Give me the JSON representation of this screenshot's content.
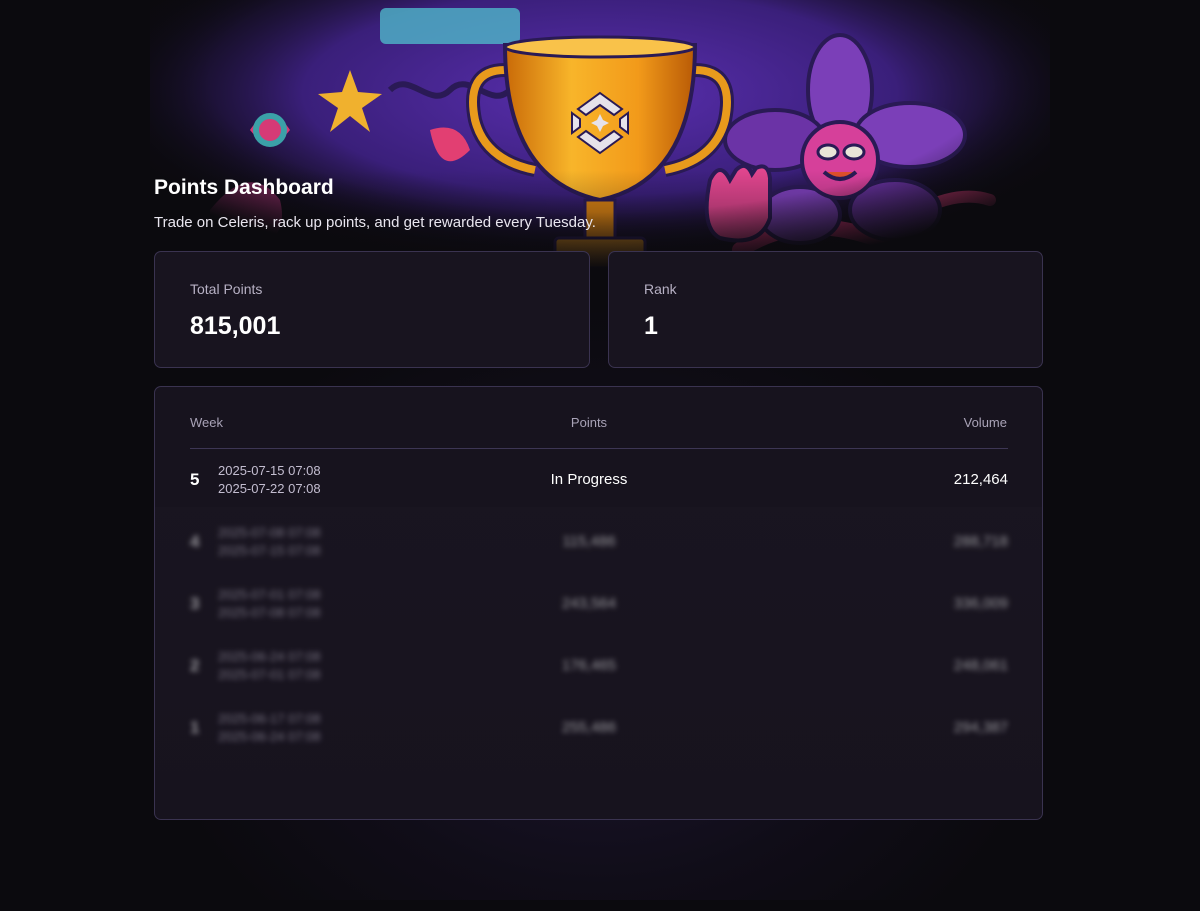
{
  "header": {
    "title": "Points Dashboard",
    "subtitle": "Trade on Celeris, rack up points, and get rewarded every Tuesday."
  },
  "stats": {
    "total_points_label": "Total Points",
    "total_points_value": "815,001",
    "rank_label": "Rank",
    "rank_value": "1"
  },
  "table": {
    "columns": [
      "Week",
      "Points",
      "Volume"
    ],
    "rows": [
      {
        "week": "5",
        "start": "2025-07-15 07:08",
        "end": "2025-07-22 07:08",
        "points": "In Progress",
        "volume": "212,464",
        "blurred": false
      },
      {
        "week": "4",
        "start": "2025-07-08 07:08",
        "end": "2025-07-15 07:08",
        "points": "115,486",
        "volume": "288,718",
        "blurred": true
      },
      {
        "week": "3",
        "start": "2025-07-01 07:08",
        "end": "2025-07-08 07:08",
        "points": "243,564",
        "volume": "336,009",
        "blurred": true
      },
      {
        "week": "2",
        "start": "2025-06-24 07:08",
        "end": "2025-07-01 07:08",
        "points": "176,465",
        "volume": "248,061",
        "blurred": true
      },
      {
        "week": "1",
        "start": "2025-06-17 07:08",
        "end": "2025-06-24 07:08",
        "points": "255,486",
        "volume": "294,387",
        "blurred": true
      }
    ]
  },
  "hero": {
    "illustration": "trophy-illustration",
    "colors": {
      "trophy": "#f0a21c",
      "background": "#3a1f7a",
      "flower": "#7b3fb8",
      "accent": "#e0357a"
    }
  }
}
